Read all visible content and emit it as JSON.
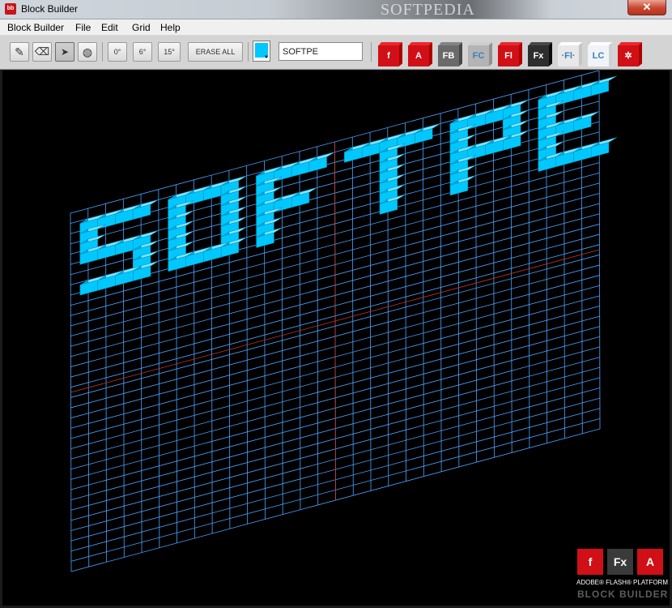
{
  "window": {
    "title": "Block Builder",
    "watermark": "SOFTPEDIA",
    "close_label": "✕"
  },
  "menu": [
    {
      "label": "Block Builder"
    },
    {
      "label": "File"
    },
    {
      "label": "Edit"
    },
    {
      "label": "Grid"
    },
    {
      "label": "Help"
    }
  ],
  "toolbar": {
    "tools": [
      {
        "name": "pencil-tool-button",
        "icon": "pencil-icon",
        "glyph": "✎"
      },
      {
        "name": "eraser-tool-button",
        "icon": "eraser-icon",
        "glyph": "⌫"
      },
      {
        "name": "select-tool-button",
        "icon": "cursor-arrow-icon",
        "glyph": "➤",
        "active": true
      },
      {
        "name": "rotate-tool-button",
        "icon": "globe-icon",
        "glyph": "◍"
      }
    ],
    "angles": [
      "0°",
      "6°",
      "15°"
    ],
    "erase_all": "ERASE ALL",
    "block_color": "#00c8ff",
    "text_value": "SOFTPE",
    "brands": [
      {
        "label": "f",
        "color": "#d01016"
      },
      {
        "label": "A",
        "color": "#d01016"
      },
      {
        "label": "FB",
        "color": "#6a6a6a"
      },
      {
        "label": "FC",
        "color": "#b4b4b4"
      },
      {
        "label": "Fl",
        "color": "#d01016"
      },
      {
        "label": "Fx",
        "color": "#2e2e2e"
      },
      {
        "label": "·Fl·",
        "color": "#e8e8e8"
      },
      {
        "label": "LC",
        "color": "#f0f4f8"
      },
      {
        "label": "✲",
        "color": "#d01016"
      }
    ]
  },
  "canvas": {
    "text": "SOFTPE",
    "grid_color": "#4aa3ff",
    "axis_color": "#c8342b",
    "block_color": "#00c8ff"
  },
  "footer_logo": {
    "blocks": [
      {
        "label": "f",
        "color": "#d01016"
      },
      {
        "label": "Fx",
        "color": "#3a3a3a"
      },
      {
        "label": "A",
        "color": "#d01016"
      }
    ],
    "line1": "ADOBE® FLASH® PLATFORM",
    "line2": "BLOCK BUILDER"
  }
}
